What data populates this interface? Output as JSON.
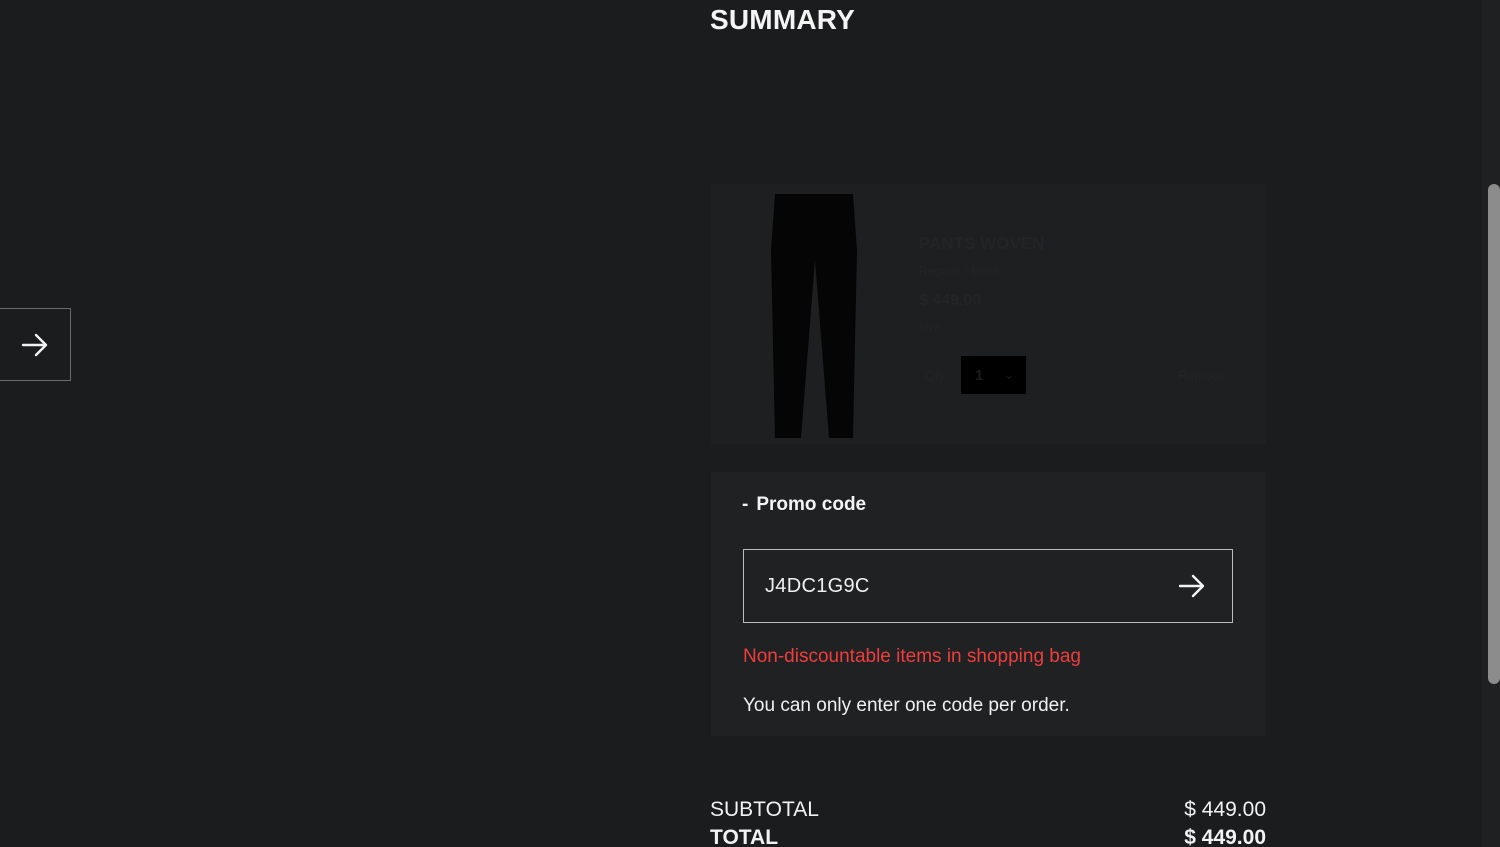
{
  "summary": {
    "title": "SUMMARY"
  },
  "side_nav": {
    "icon": "arrow-right-icon"
  },
  "product": {
    "name": "PANTS WOVEN",
    "subtitle": "Regular / Black",
    "price": "$ 449.00",
    "size": "Size",
    "qty_label": "Qty",
    "quantity": "1",
    "remove_label": "Remove",
    "image_icon": "pants-image"
  },
  "promo": {
    "toggle_symbol": "-",
    "toggle_label": "Promo code",
    "input_value": "J4DC1G9C",
    "submit_icon": "arrow-right-icon",
    "error_message": "Non-discountable items in shopping bag",
    "note": "You can only enter one code per order.",
    "error_color": "#ef3d3d"
  },
  "totals": {
    "subtotal_label": "SUBTOTAL",
    "subtotal_value": "$ 449.00",
    "total_label": "TOTAL",
    "total_value": "$ 449.00"
  }
}
